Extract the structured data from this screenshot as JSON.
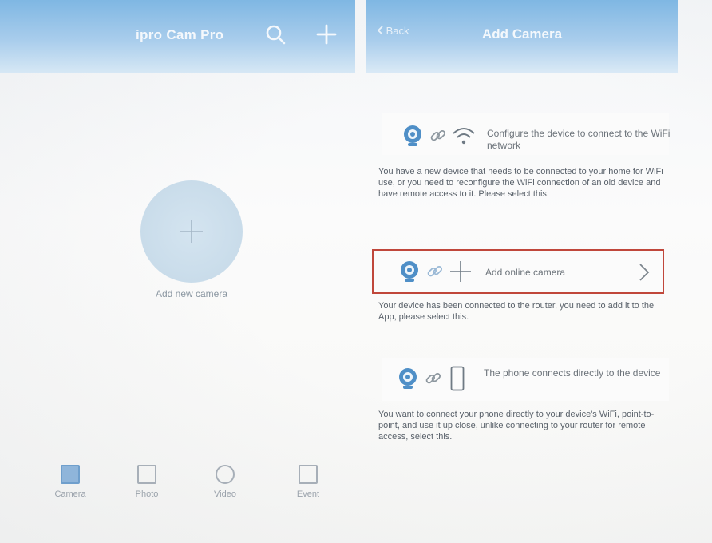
{
  "left_screen": {
    "title": "ipro Cam Pro",
    "add_label": "Add new camera",
    "tabs": [
      {
        "label": "Camera",
        "active": true
      },
      {
        "label": "Photo",
        "active": false
      },
      {
        "label": "Video",
        "active": false
      },
      {
        "label": "Event",
        "active": false
      }
    ]
  },
  "right_screen": {
    "back_label": "Back",
    "title": "Add Camera",
    "options": [
      {
        "title": "Configure the device to connect to the WiFi network",
        "description": "You have a new device that needs to be connected to your home for WiFi use, or you need to reconfigure the WiFi connection of an old device and have remote access to it. Please select this."
      },
      {
        "title": "Add online camera",
        "description": "Your device has been connected to the router, you need to add it to the App, please select this.",
        "selected": true
      },
      {
        "title": "The phone connects directly to the device",
        "description": "You want to connect your phone directly to your device's WiFi, point-to-point, and use it up close, unlike connecting to your router for remote access, select this."
      }
    ]
  },
  "colors": {
    "header": "#8fbfe6",
    "highlight_border": "#c0473b",
    "accent": "#5d9ed4"
  }
}
